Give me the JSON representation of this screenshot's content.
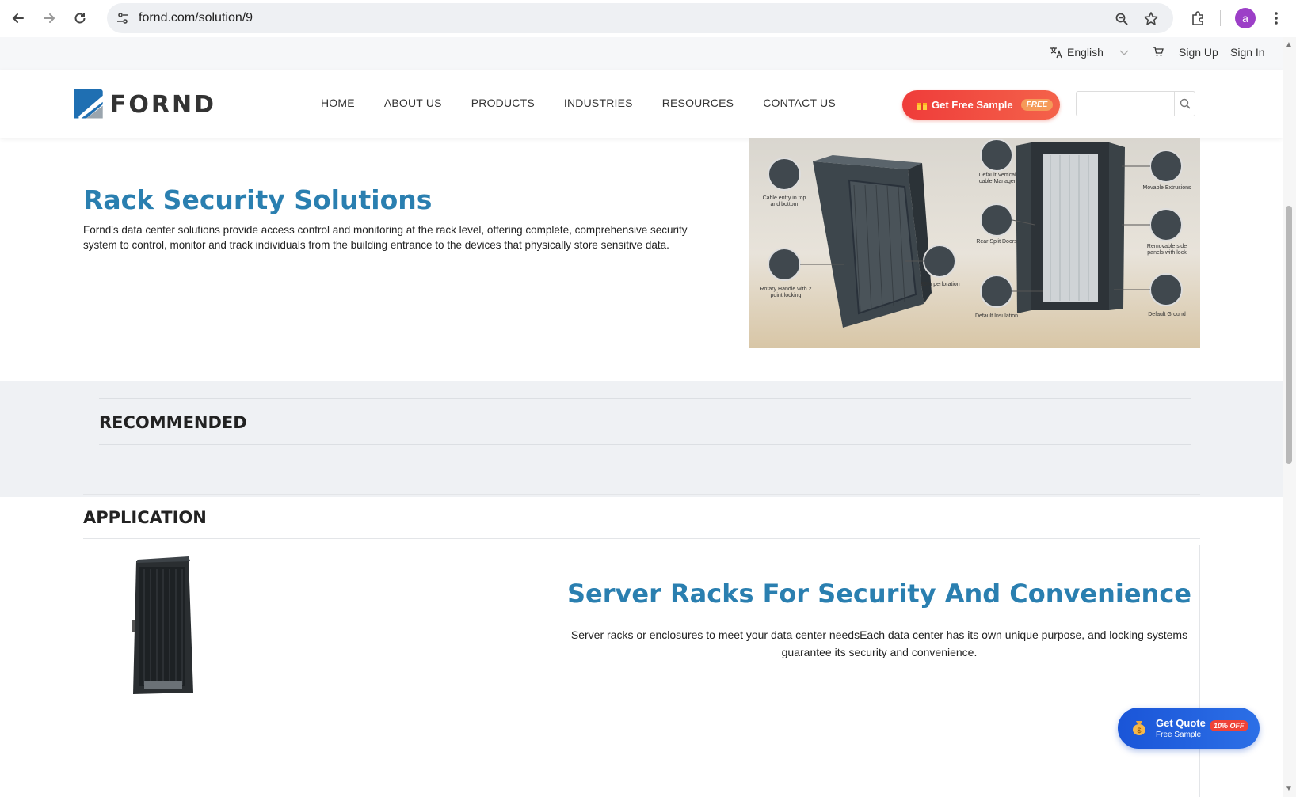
{
  "browser": {
    "url": "fornd.com/solution/9",
    "avatar_letter": "a"
  },
  "topbar": {
    "language": "English",
    "sign_up": "Sign Up",
    "sign_in": "Sign In"
  },
  "header": {
    "logo_text": "FORND",
    "menu": [
      "HOME",
      "ABOUT US",
      "PRODUCTS",
      "INDUSTRIES",
      "RESOURCES",
      "CONTACT US"
    ],
    "sample_button": "Get Free Sample",
    "sample_badge": "FREE",
    "search_placeholder": ""
  },
  "hero": {
    "title": "Rack Security Solutions",
    "description": "Fornd's data center solutions provide access control and monitoring at the rack level, offering complete, comprehensive security system to control, monitor and track individuals from the building entrance to the devices that physically store sensitive data.",
    "image_labels": {
      "cable_entry": "Cable entry in top and bottom",
      "rotary_handle": "Rotary Handle with 2 point locking",
      "perforation": "86% perforation",
      "vertical_cable": "Default Vertical cable Manager",
      "rear_split": "Rear Split Doors",
      "insulation": "Default Insulation",
      "extrusions": "Movable Extrusions",
      "side_panels": "Removable side panels with lock",
      "ground": "Default Ground"
    }
  },
  "recommended": {
    "title": "RECOMMENDED"
  },
  "application": {
    "title": "APPLICATION",
    "heading": "Server Racks For Security And Convenience",
    "description": "Server racks or enclosures to meet your data center needsEach data center has its own unique purpose, and locking systems guarantee its security and convenience."
  },
  "quote": {
    "title": "Get Quote",
    "subtitle": "Free Sample",
    "badge": "10% OFF"
  },
  "colors": {
    "accent_blue": "#2a7fb0",
    "sample_red": "#ef3c3a",
    "quote_blue": "#1a55d8"
  }
}
